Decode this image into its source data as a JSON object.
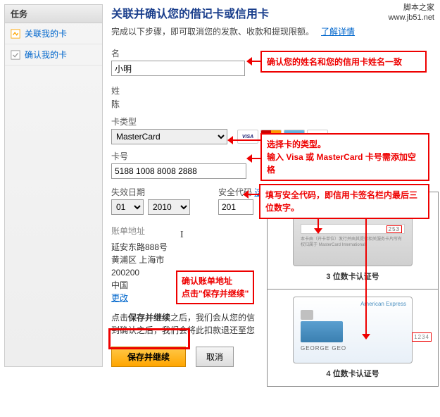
{
  "watermark": {
    "line1": "脚本之家",
    "line2": "www.jb51.net"
  },
  "sidebar": {
    "header": "任务",
    "items": [
      {
        "label": "关联我的卡"
      },
      {
        "label": "确认我的卡"
      }
    ]
  },
  "page": {
    "title": "关联并确认您的借记卡或信用卡",
    "subtitle": "完成以下步骤，即可取消您的发款、收款和提现限额。",
    "learnMore": "了解详情"
  },
  "form": {
    "firstNameLabel": "名",
    "firstName": "小明",
    "lastNameLabel": "姓",
    "lastName": "陈",
    "cardTypeLabel": "卡类型",
    "cardType": "MasterCard",
    "cardNoLabel": "卡号",
    "cardNo": "5188 1008 8008 2888",
    "expiryLabel": "失效日期",
    "expiryMonth": "01",
    "expiryYear": "2010",
    "cvvLabel": "安全代码",
    "cvvHelp": "这是—么？",
    "cvv": "201"
  },
  "logos": {
    "visa": "VISA",
    "mc": "",
    "amex": "AMEX",
    "disc": "DISCOVER"
  },
  "billing": {
    "header": "账单地址",
    "line1": "延安东路888号",
    "line2": "黄浦区 上海市",
    "line3": "200200",
    "line4": "中国",
    "change": "更改"
  },
  "confirm": {
    "text1": "点击",
    "bold": "保存并继续",
    "text2": "之后，我们会从您的信",
    "text3": "到确认之后，我们会将此扣款退还至您"
  },
  "buttons": {
    "save": "保存并继续",
    "cancel": "取消"
  },
  "callouts": {
    "c1": "确认您的姓名和您的信用卡姓名一致",
    "c2a": "选择卡的类型。",
    "c2b": "输入 Visa 或 MasterCard 卡号需添加空格",
    "c3a": "填写安全代码，即信用卡签名栏内最后三",
    "c3b": "位数字。",
    "c4a": "确认账单地址",
    "c4b": "点击\"保存并继续\""
  },
  "cards": {
    "cvv1": "253",
    "caption1": "3 位数卡认证号",
    "brand2": "American Express",
    "name2": "GEORGE GEO",
    "cvv2": "1234",
    "caption2": "4 位数卡认证号",
    "mcText": "本卡由（开卡单位）发行并由其提供相关服务卡片所有权归属于 MasterCard International"
  }
}
